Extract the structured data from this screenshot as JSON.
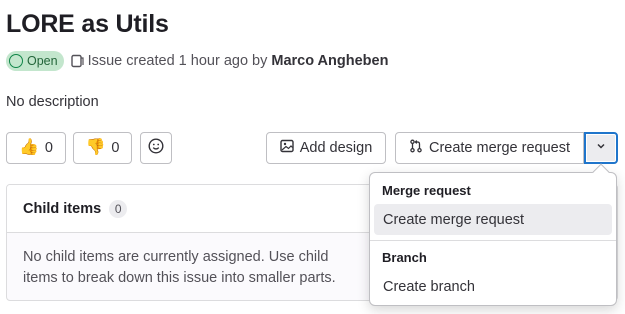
{
  "issue": {
    "title": "LORE as Utils",
    "status_badge": "Open",
    "created_text": "Issue created 1 hour ago by",
    "author": "Marco Angheben",
    "description": "No description"
  },
  "reactions": {
    "thumbs_up_emoji": "👍",
    "thumbs_up_count": "0",
    "thumbs_down_emoji": "👎",
    "thumbs_down_count": "0",
    "add_reaction_icon": "smiley-icon"
  },
  "actions": {
    "add_design_label": "Add design",
    "create_mr_label": "Create merge request",
    "toggle_icon": "chevron-down-icon"
  },
  "child_items": {
    "header": "Child items",
    "count": "0",
    "empty_text": "No child items are currently assigned. Use child items to break down this issue into smaller parts."
  },
  "dropdown": {
    "group1_label": "Merge request",
    "group1_items": [
      "Create merge request"
    ],
    "group2_label": "Branch",
    "group2_items": [
      "Create branch"
    ]
  },
  "colors": {
    "accent_focus": "#1f75cb",
    "open_badge_bg": "#c3e6cd",
    "open_badge_fg": "#24663b"
  }
}
